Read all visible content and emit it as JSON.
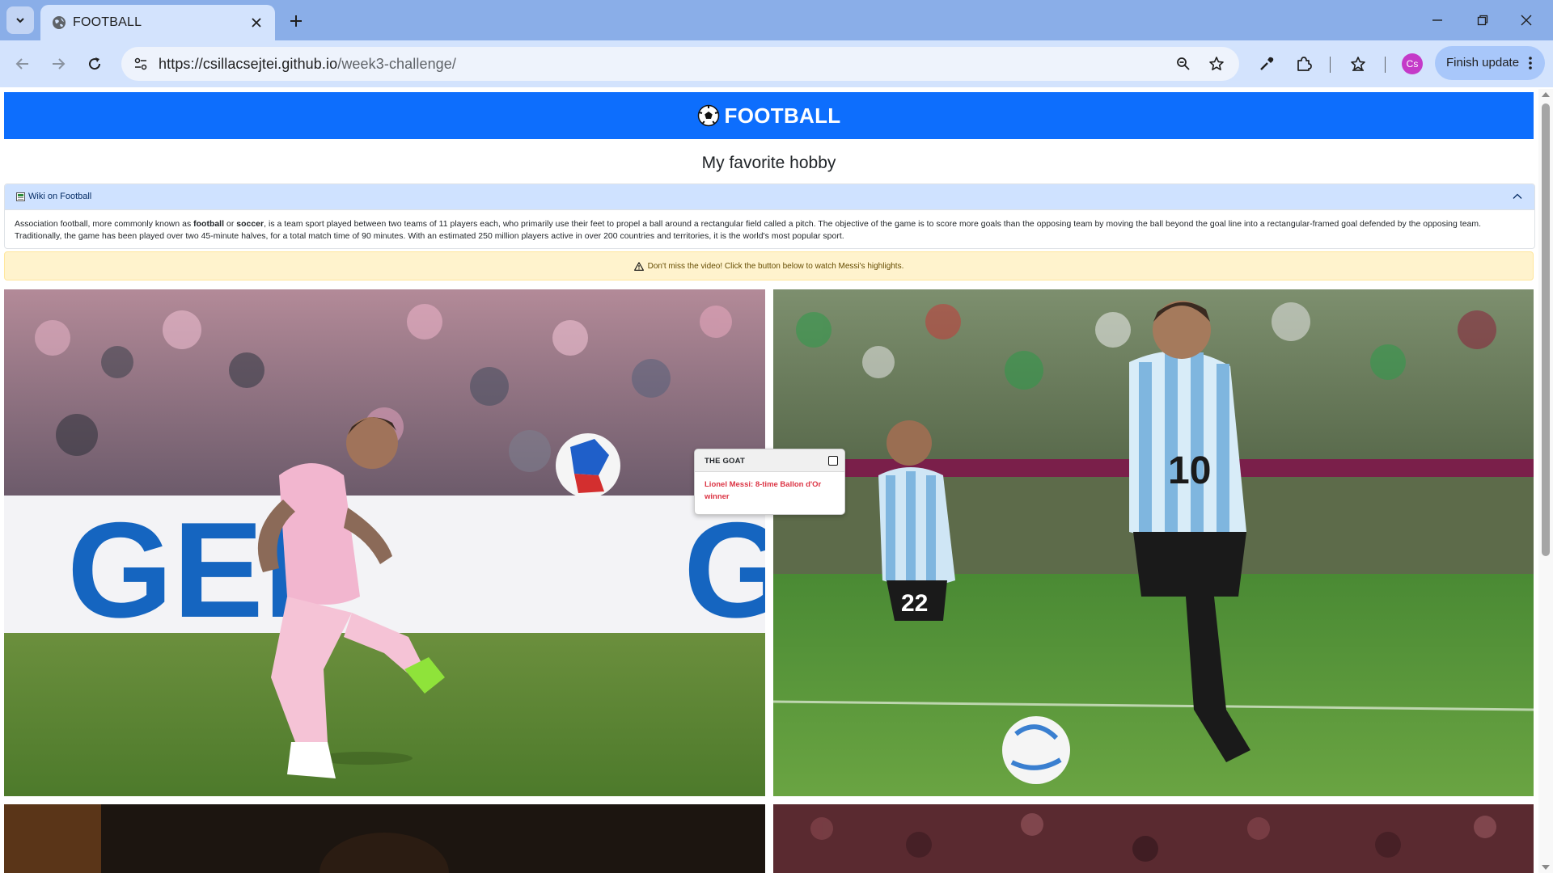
{
  "browser": {
    "tab_title": "FOOTBALL",
    "url_host": "https://csillacsejtei.github.io",
    "url_path": "/week3-challenge/",
    "profile_initials": "Cs",
    "update_label": "Finish update",
    "icons": [
      "tab-search-icon",
      "globe-icon",
      "close-icon",
      "plus-icon",
      "minimize-icon",
      "restore-icon",
      "back-icon",
      "forward-icon",
      "reload-icon",
      "site-info-icon",
      "zoom-icon",
      "star-icon",
      "eyedropper-icon",
      "extensions-icon",
      "bookmarks-icon",
      "more-icon"
    ]
  },
  "page": {
    "header_title": "FOOTBALL",
    "header_icon": "soccer-ball-icon",
    "subtitle": "My favorite hobby",
    "accordion": {
      "title": "Wiki on Football",
      "body_intro": "Association football, more commonly known as ",
      "term1": "football",
      "connector": " or ",
      "term2": "soccer",
      "body_rest": ", is a team sport played between two teams of 11 players each, who primarily use their feet to propel a ball around a rectangular field called a pitch. The objective of the game is to score more goals than the opposing team by moving the ball beyond the goal line into a rectangular-framed goal defended by the opposing team. Traditionally, the game has been played over two 45-minute halves, for a total match time of 90 minutes. With an estimated 250 million players active in over 200 countries and territories, it is the world's most popular sport."
    },
    "alert_text": "Don't miss the video! Click the button below to watch Messi's highlights.",
    "popover": {
      "title": "THE GOAT",
      "body": "Lionel Messi: 8-time Ballon d'Or winner"
    },
    "photo_texts": {
      "banner_left": "GEI",
      "banner_right": "G",
      "jersey_number": "10",
      "jersey_number_2": "22"
    }
  }
}
